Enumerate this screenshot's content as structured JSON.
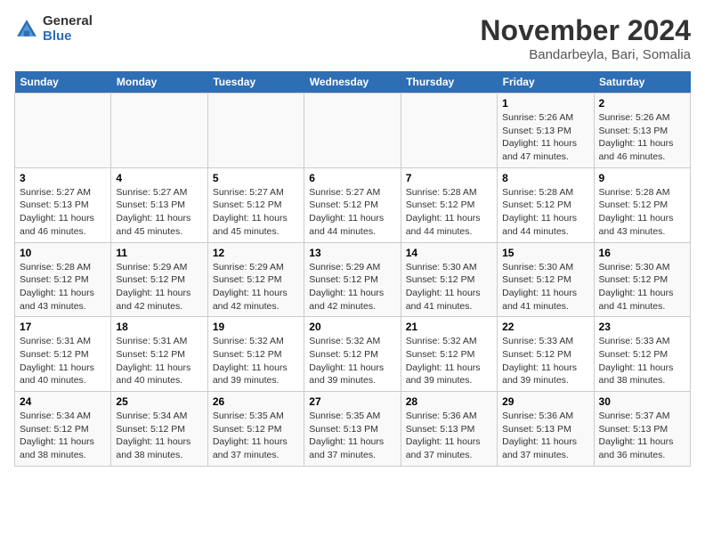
{
  "logo": {
    "general": "General",
    "blue": "Blue"
  },
  "title": "November 2024",
  "subtitle": "Bandarbeyla, Bari, Somalia",
  "days_of_week": [
    "Sunday",
    "Monday",
    "Tuesday",
    "Wednesday",
    "Thursday",
    "Friday",
    "Saturday"
  ],
  "weeks": [
    [
      {
        "day": "",
        "info": ""
      },
      {
        "day": "",
        "info": ""
      },
      {
        "day": "",
        "info": ""
      },
      {
        "day": "",
        "info": ""
      },
      {
        "day": "",
        "info": ""
      },
      {
        "day": "1",
        "info": "Sunrise: 5:26 AM\nSunset: 5:13 PM\nDaylight: 11 hours\nand 47 minutes."
      },
      {
        "day": "2",
        "info": "Sunrise: 5:26 AM\nSunset: 5:13 PM\nDaylight: 11 hours\nand 46 minutes."
      }
    ],
    [
      {
        "day": "3",
        "info": "Sunrise: 5:27 AM\nSunset: 5:13 PM\nDaylight: 11 hours\nand 46 minutes."
      },
      {
        "day": "4",
        "info": "Sunrise: 5:27 AM\nSunset: 5:13 PM\nDaylight: 11 hours\nand 45 minutes."
      },
      {
        "day": "5",
        "info": "Sunrise: 5:27 AM\nSunset: 5:12 PM\nDaylight: 11 hours\nand 45 minutes."
      },
      {
        "day": "6",
        "info": "Sunrise: 5:27 AM\nSunset: 5:12 PM\nDaylight: 11 hours\nand 44 minutes."
      },
      {
        "day": "7",
        "info": "Sunrise: 5:28 AM\nSunset: 5:12 PM\nDaylight: 11 hours\nand 44 minutes."
      },
      {
        "day": "8",
        "info": "Sunrise: 5:28 AM\nSunset: 5:12 PM\nDaylight: 11 hours\nand 44 minutes."
      },
      {
        "day": "9",
        "info": "Sunrise: 5:28 AM\nSunset: 5:12 PM\nDaylight: 11 hours\nand 43 minutes."
      }
    ],
    [
      {
        "day": "10",
        "info": "Sunrise: 5:28 AM\nSunset: 5:12 PM\nDaylight: 11 hours\nand 43 minutes."
      },
      {
        "day": "11",
        "info": "Sunrise: 5:29 AM\nSunset: 5:12 PM\nDaylight: 11 hours\nand 42 minutes."
      },
      {
        "day": "12",
        "info": "Sunrise: 5:29 AM\nSunset: 5:12 PM\nDaylight: 11 hours\nand 42 minutes."
      },
      {
        "day": "13",
        "info": "Sunrise: 5:29 AM\nSunset: 5:12 PM\nDaylight: 11 hours\nand 42 minutes."
      },
      {
        "day": "14",
        "info": "Sunrise: 5:30 AM\nSunset: 5:12 PM\nDaylight: 11 hours\nand 41 minutes."
      },
      {
        "day": "15",
        "info": "Sunrise: 5:30 AM\nSunset: 5:12 PM\nDaylight: 11 hours\nand 41 minutes."
      },
      {
        "day": "16",
        "info": "Sunrise: 5:30 AM\nSunset: 5:12 PM\nDaylight: 11 hours\nand 41 minutes."
      }
    ],
    [
      {
        "day": "17",
        "info": "Sunrise: 5:31 AM\nSunset: 5:12 PM\nDaylight: 11 hours\nand 40 minutes."
      },
      {
        "day": "18",
        "info": "Sunrise: 5:31 AM\nSunset: 5:12 PM\nDaylight: 11 hours\nand 40 minutes."
      },
      {
        "day": "19",
        "info": "Sunrise: 5:32 AM\nSunset: 5:12 PM\nDaylight: 11 hours\nand 39 minutes."
      },
      {
        "day": "20",
        "info": "Sunrise: 5:32 AM\nSunset: 5:12 PM\nDaylight: 11 hours\nand 39 minutes."
      },
      {
        "day": "21",
        "info": "Sunrise: 5:32 AM\nSunset: 5:12 PM\nDaylight: 11 hours\nand 39 minutes."
      },
      {
        "day": "22",
        "info": "Sunrise: 5:33 AM\nSunset: 5:12 PM\nDaylight: 11 hours\nand 39 minutes."
      },
      {
        "day": "23",
        "info": "Sunrise: 5:33 AM\nSunset: 5:12 PM\nDaylight: 11 hours\nand 38 minutes."
      }
    ],
    [
      {
        "day": "24",
        "info": "Sunrise: 5:34 AM\nSunset: 5:12 PM\nDaylight: 11 hours\nand 38 minutes."
      },
      {
        "day": "25",
        "info": "Sunrise: 5:34 AM\nSunset: 5:12 PM\nDaylight: 11 hours\nand 38 minutes."
      },
      {
        "day": "26",
        "info": "Sunrise: 5:35 AM\nSunset: 5:12 PM\nDaylight: 11 hours\nand 37 minutes."
      },
      {
        "day": "27",
        "info": "Sunrise: 5:35 AM\nSunset: 5:13 PM\nDaylight: 11 hours\nand 37 minutes."
      },
      {
        "day": "28",
        "info": "Sunrise: 5:36 AM\nSunset: 5:13 PM\nDaylight: 11 hours\nand 37 minutes."
      },
      {
        "day": "29",
        "info": "Sunrise: 5:36 AM\nSunset: 5:13 PM\nDaylight: 11 hours\nand 37 minutes."
      },
      {
        "day": "30",
        "info": "Sunrise: 5:37 AM\nSunset: 5:13 PM\nDaylight: 11 hours\nand 36 minutes."
      }
    ]
  ]
}
